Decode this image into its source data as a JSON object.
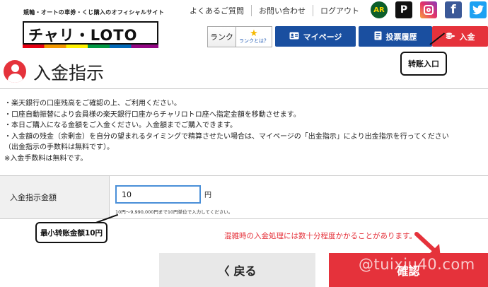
{
  "header": {
    "tagline": "競輪・オートの車券・くじ購入のオフィシャルサイト",
    "logo_text": "チャリ・LOTO",
    "top_links": [
      "よくあるご質問",
      "お問い合わせ",
      "ログアウト"
    ],
    "social": [
      {
        "name": "autorace-icon",
        "glyph": "AR"
      },
      {
        "name": "parking-p-icon",
        "glyph": "P"
      },
      {
        "name": "instagram-icon",
        "glyph": ""
      },
      {
        "name": "facebook-icon",
        "glyph": "f"
      },
      {
        "name": "twitter-icon",
        "glyph": "🐦"
      }
    ],
    "rank_label": "ランク",
    "rank_star": "★",
    "rank_what": "ランクとは？",
    "nav": {
      "mypage": "マイページ",
      "history": "投票履歴",
      "deposit": "入金"
    }
  },
  "annotations": {
    "entry_callout": "转账入口",
    "min_callout": "最小转账金额10円"
  },
  "page": {
    "title": "入金指示",
    "notes": [
      "・楽天銀行の口座残高をご確認の上、ご利用ください。",
      "・口座自動振替により会員様の楽天銀行口座からチャリロトロ座へ指定金額を移動させます。",
      "・本日ご購入になる金額をご入金ください。入金額までご購入できます。",
      "・入金額の残金（余剰金）を自分の望まれるタイミングで精算させたい場合は、マイページの「出金指示」により出金指示を行ってください",
      "（出金指示の手数料は無料です）。",
      "※入金手数料は無料です。"
    ]
  },
  "form": {
    "label": "入金指示金額",
    "amount_value": "10",
    "unit": "円",
    "hint": "10円～9,990,000円まで10円単位で入力してください。"
  },
  "warning": "混雑時の入金処理には数十分程度かかることがあります。",
  "buttons": {
    "back_label": "戻る",
    "back_chevron": "〈",
    "confirm_label": "確認"
  },
  "watermark": "@tuixiu40.com",
  "colors": {
    "brand_blue": "#1a4fa0",
    "brand_red": "#e5323b",
    "input_border": "#4a8fd8"
  }
}
